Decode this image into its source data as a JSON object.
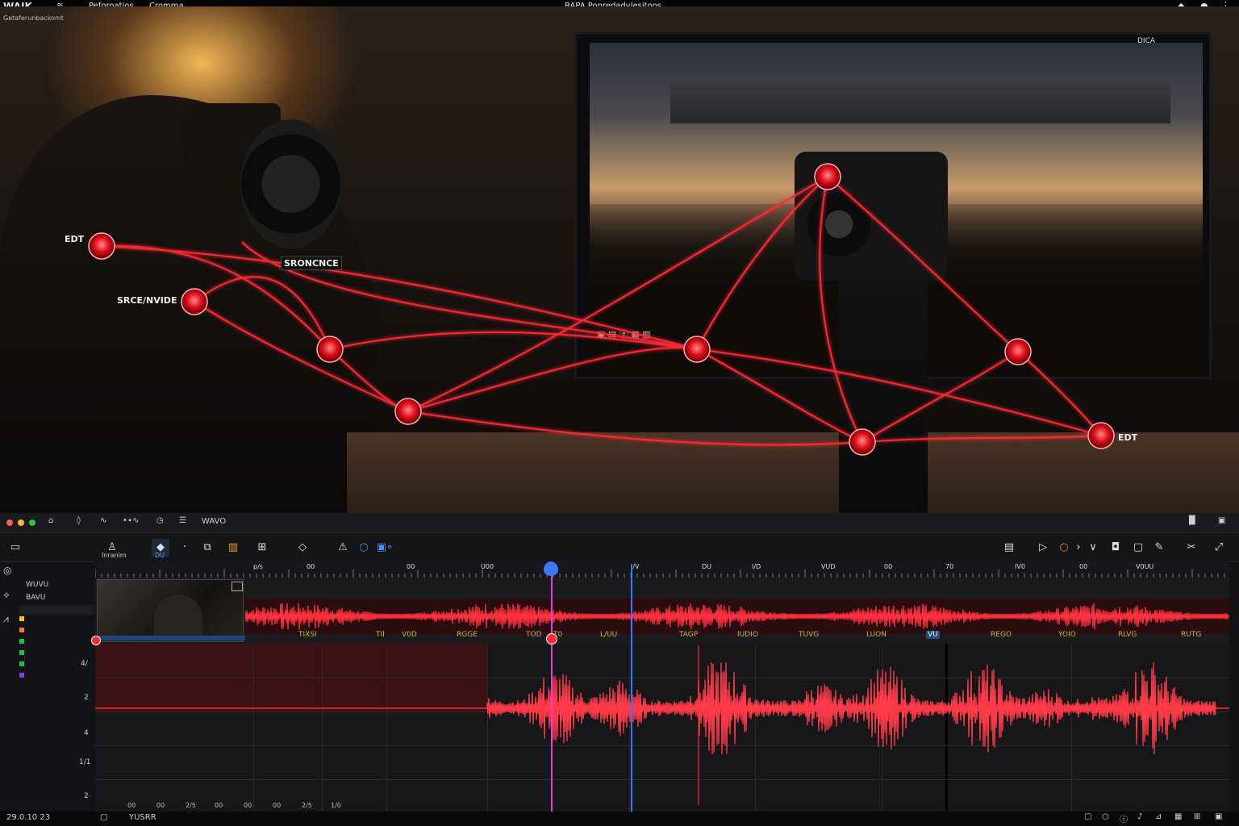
{
  "titlebar": {
    "app_name": "WAIK",
    "app_subtitle": "Getaferunbackomt",
    "menu_text": "Peforoatios",
    "menu_text_2": "Cromma",
    "window_title": "RAPA Ponredadvlesitoos"
  },
  "scene": {
    "nodes": [
      {
        "label": "EDT"
      },
      {
        "label": "SRCE/NVIDE"
      },
      {
        "label": "SRONCNCE"
      },
      {
        "label": "EDT"
      }
    ],
    "screen_controls": "DICA"
  },
  "editor": {
    "project_label": "WAVO",
    "toolbar": {
      "pencil_label": "Inranim",
      "marker_label": "DU"
    },
    "ruler_ticks": [
      "p/s",
      "00",
      "00",
      "U00",
      "",
      "I/V",
      "DU",
      "I/D",
      "VUD",
      "00",
      "70",
      "IV0",
      "00",
      "V0UU"
    ],
    "track_labels": [
      "TIXSI",
      "TII",
      "V0D",
      "RGGE",
      "TOD",
      "T0",
      "L/UU",
      "TAGP",
      "IUDIO",
      "TUVG",
      "LUON",
      "VU",
      "REGO",
      "YOIO",
      "RLVG",
      "RUTG"
    ],
    "left_panel": {
      "header": "WUVU",
      "sub": "BAVU",
      "row_values": [
        "4/",
        "2",
        "4",
        "1/1",
        "2"
      ]
    },
    "bottom_ticks": [
      "00",
      "00",
      "2/5",
      "00",
      "00",
      "00",
      "2/5",
      "1/0"
    ],
    "status": {
      "timecode": "29.0.10 23",
      "label": "YUSRR"
    }
  },
  "colors": {
    "accent_red": "#ff2a36",
    "playhead_pink": "#e040e0",
    "playhead_blue": "#3a78ff",
    "label_yellow": "#d4b23a"
  }
}
